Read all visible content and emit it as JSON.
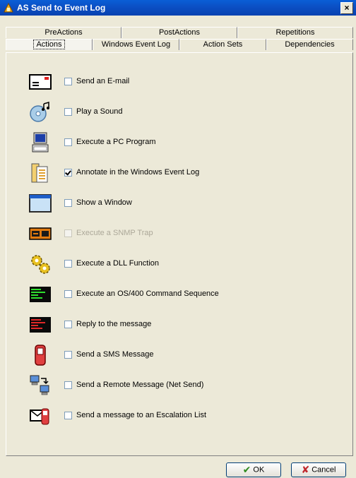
{
  "window": {
    "title": "AS Send to Event Log",
    "close_glyph": "×"
  },
  "tabs": {
    "back_row": [
      "PreActions",
      "PostActions",
      "Repetitions"
    ],
    "front_row": [
      "Actions",
      "Windows Event Log",
      "Action Sets",
      "Dependencies"
    ],
    "selected": "Actions"
  },
  "actions": [
    {
      "label": "Send an E-mail",
      "checked": false,
      "enabled": true,
      "icon": "email-icon"
    },
    {
      "label": "Play a Sound",
      "checked": false,
      "enabled": true,
      "icon": "sound-icon"
    },
    {
      "label": "Execute a PC Program",
      "checked": false,
      "enabled": true,
      "icon": "pc-program-icon"
    },
    {
      "label": "Annotate in the Windows Event Log",
      "checked": true,
      "enabled": true,
      "icon": "event-log-icon"
    },
    {
      "label": "Show a Window",
      "checked": false,
      "enabled": true,
      "icon": "window-icon"
    },
    {
      "label": "Execute a SNMP Trap",
      "checked": false,
      "enabled": false,
      "icon": "snmp-icon"
    },
    {
      "label": "Execute a DLL Function",
      "checked": false,
      "enabled": true,
      "icon": "gears-icon"
    },
    {
      "label": "Execute an OS/400 Command Sequence",
      "checked": false,
      "enabled": true,
      "icon": "os400-terminal-icon"
    },
    {
      "label": "Reply to the message",
      "checked": false,
      "enabled": true,
      "icon": "reply-terminal-icon"
    },
    {
      "label": "Send a SMS Message",
      "checked": false,
      "enabled": true,
      "icon": "mobile-phone-icon"
    },
    {
      "label": "Send a Remote Message (Net Send)",
      "checked": false,
      "enabled": true,
      "icon": "network-computers-icon"
    },
    {
      "label": "Send a message to an Escalation List",
      "checked": false,
      "enabled": true,
      "icon": "escalation-icon"
    }
  ],
  "buttons": {
    "ok": "OK",
    "cancel": "Cancel"
  },
  "colors": {
    "title_bar": "#0b4fc4",
    "dialog_bg": "#ece9d8",
    "ok_check": "#2e8b1e",
    "cancel_x": "#c0282d"
  }
}
